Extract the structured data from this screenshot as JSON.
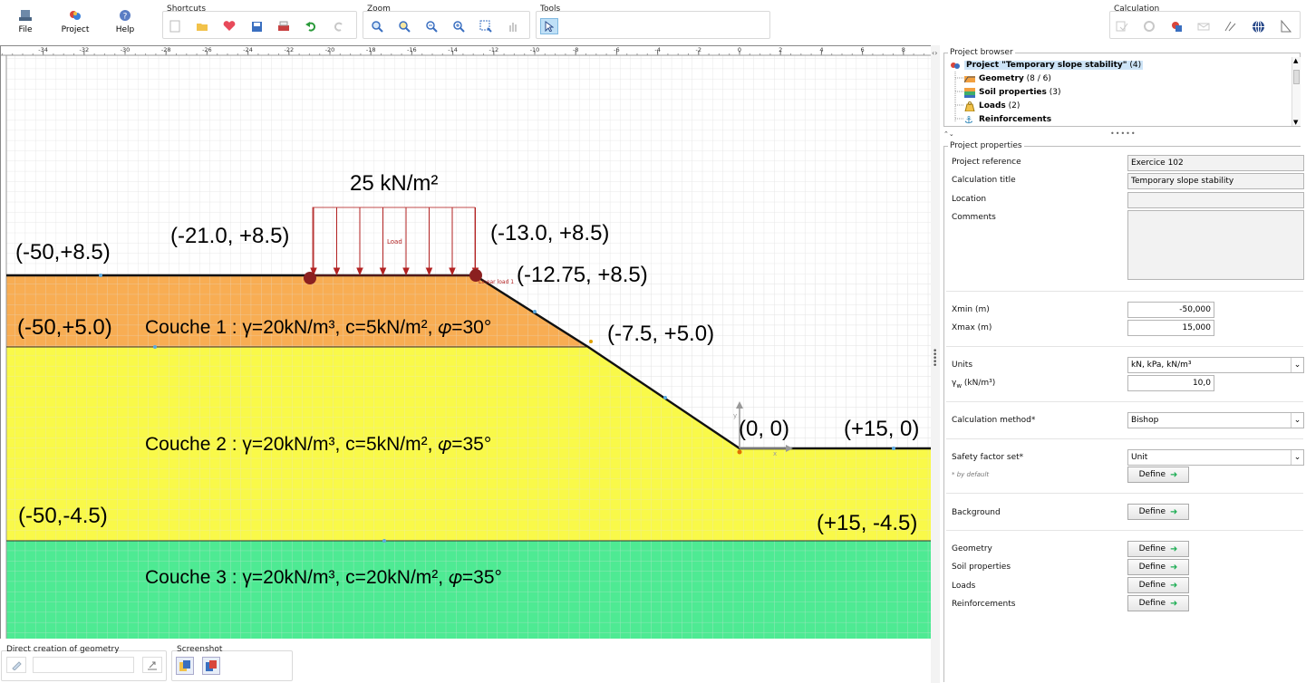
{
  "toolbar": {
    "main": [
      {
        "label": "File",
        "icon": "file-icon"
      },
      {
        "label": "Project",
        "icon": "project-icon"
      },
      {
        "label": "Help",
        "icon": "help-icon"
      }
    ],
    "groups": {
      "shortcuts": "Shortcuts",
      "zoom": "Zoom",
      "tools": "Tools",
      "calculation": "Calculation"
    }
  },
  "axis": {
    "ticks": [
      "-34",
      "-32",
      "-30",
      "-28",
      "-26",
      "-24",
      "-22",
      "-20",
      "-18",
      "-16",
      "-14",
      "-12",
      "-10",
      "-8",
      "-6",
      "-4",
      "-2",
      "0",
      "2",
      "4",
      "6",
      "8"
    ]
  },
  "canvas": {
    "load_label": "25 kN/m²",
    "load_small_label": "Load",
    "load_item_label": "Linear load 1",
    "coords": {
      "c1": "(-50,+8.5)",
      "c2": "(-21.0, +8.5)",
      "c3": "(-13.0, +8.5)",
      "c4": "(-12.75, +8.5)",
      "c5": "(-50,+5.0)",
      "c6": "(-7.5, +5.0)",
      "c7": "(0, 0)",
      "c8": "(+15, 0)",
      "c9": "(-50,-4.5)",
      "c10": "(+15, -4.5)"
    },
    "layers": [
      {
        "label": "Couche 1 : γ=20kN/m³, c=5kN/m²,  𝜑=30°",
        "color": "#f8a94a"
      },
      {
        "label": "Couche 2 : γ=20kN/m³, c=5kN/m²,  𝜑=35°",
        "color": "#f8f83a"
      },
      {
        "label": "Couche 3 : γ=20kN/m³, c=20kN/m²,  𝜑=35°",
        "color": "#3fe88a"
      }
    ],
    "origin": {
      "x": "x",
      "y": "y"
    }
  },
  "bottom": {
    "direct_creation": "Direct creation of geometry",
    "screenshot": "Screenshot"
  },
  "browser": {
    "title": "Project browser",
    "project": "Project \"Temporary slope stability\"",
    "project_count": "(4)",
    "items": [
      {
        "name": "Geometry",
        "count": "(8 / 6)"
      },
      {
        "name": "Soil properties",
        "count": "(3)"
      },
      {
        "name": "Loads",
        "count": "(2)"
      },
      {
        "name": "Reinforcements",
        "count": ""
      }
    ]
  },
  "properties": {
    "title": "Project properties",
    "project_reference_label": "Project reference",
    "project_reference_value": "Exercice 102",
    "calculation_title_label": "Calculation title",
    "calculation_title_value": "Temporary slope stability",
    "location_label": "Location",
    "location_value": "",
    "comments_label": "Comments",
    "xmin_label": "Xmin (m)",
    "xmin_value": "-50,000",
    "xmax_label": "Xmax (m)",
    "xmax_value": "15,000",
    "units_label": "Units",
    "units_value": "kN, kPa, kN/m³",
    "gamma_w_label": "γw (kN/m³)",
    "gamma_w_value": "10,0",
    "method_label": "Calculation method*",
    "method_value": "Bishop",
    "safety_label": "Safety factor set*",
    "safety_value": "Unit",
    "default_note": "* by default",
    "background_label": "Background",
    "geometry_label": "Geometry",
    "soil_label": "Soil properties",
    "loads_label": "Loads",
    "reinforcements_label": "Reinforcements",
    "define_label": "Define"
  },
  "colors": {
    "accent_select": "#bfe0f7",
    "load_color": "#b22222",
    "define_arrow": "#1fae55"
  }
}
